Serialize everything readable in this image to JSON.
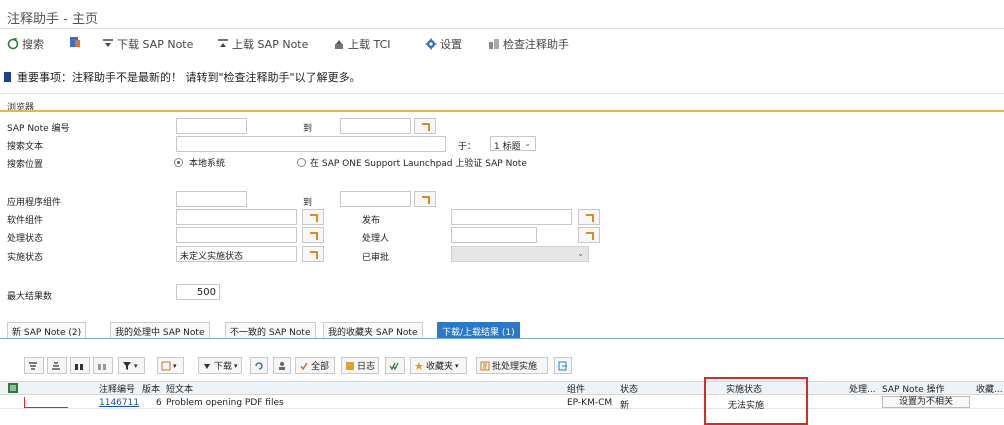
{
  "window": {
    "title": "注释助手 - 主页"
  },
  "toolbar": [
    {
      "label": "搜索",
      "icon": "refresh-icon"
    },
    {
      "label": "",
      "icon": "book-icon"
    },
    {
      "label": "下载 SAP Note",
      "icon": "download-icon"
    },
    {
      "label": "上载 SAP Note",
      "icon": "upload-icon"
    },
    {
      "label": "上载 TCI",
      "icon": "upload-tci-icon"
    },
    {
      "label": "设置",
      "icon": "gear-icon"
    },
    {
      "label": "检查注释助手",
      "icon": "check-icon"
    }
  ],
  "notice": {
    "text": "重要事项：注释助手不是最新的！ 请转到\"检查注释助手\"以了解更多。"
  },
  "browser": {
    "group_title": "浏览器",
    "sap_note_number_label": "SAP Note 编号",
    "to_label": "到",
    "search_text_label": "搜索文本",
    "in_label": "于：",
    "in_value": "1 标题",
    "search_location_label": "搜索位置",
    "local_system_label": "本地系统",
    "launchpad_label": "在 SAP ONE Support Launchpad 上验证 SAP Note",
    "app_component_label": "应用程序组件",
    "app_component_to_label": "到",
    "software_component_label": "软件组件",
    "release_label": "发布",
    "processing_status_label": "处理状态",
    "processor_label": "处理人",
    "implementation_status_label": "实施状态",
    "implementation_status_value": "未定义实施状态",
    "approved_label": "已审批",
    "max_results_label": "最大结果数",
    "max_results_value": "500"
  },
  "tabs": [
    {
      "label": "新 SAP Note (2)",
      "active": false
    },
    {
      "label": "我的处理中 SAP Note",
      "active": false
    },
    {
      "label": "不一致的 SAP Note",
      "active": false
    },
    {
      "label": "我的收藏夹 SAP Note",
      "active": false
    },
    {
      "label": "下载/上载结果 (1)",
      "active": true
    }
  ],
  "alv_toolbar": {
    "download_label": "下载",
    "all_label": "全部",
    "log_label": "日志",
    "favorites_label": "收藏夹",
    "batch_label": "批处理实施"
  },
  "table": {
    "columns": {
      "note_number": "注释编号",
      "version": "版本",
      "short_text": "短文本",
      "component": "组件",
      "status": "状态",
      "impl_status": "实施状态",
      "processor": "处理...",
      "note_action": "SAP Note 操作",
      "favorite": "收藏..."
    },
    "rows": [
      {
        "note_number": "1146711",
        "version": "6",
        "short_text": "Problem opening PDF files",
        "component": "EP-KM-CM",
        "status": "新",
        "impl_status": "无法实施",
        "note_action": "设置为不相关"
      }
    ]
  },
  "colors": {
    "accent": "#2a79c9",
    "gold": "#e8b34a",
    "highlight": "#d42a2a"
  }
}
